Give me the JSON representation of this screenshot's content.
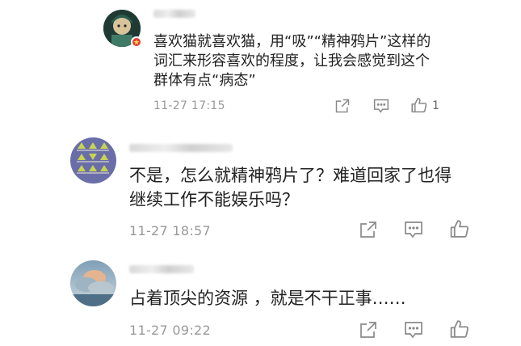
{
  "comments": [
    {
      "text_lines": [
        "喜欢猫就喜欢猫，用“吸”“精神鸦片”这样的",
        "词汇来形容喜欢的程度，让我会感觉到这个",
        "群体有点“病态”"
      ],
      "time": "11-27 17:15",
      "like_count": "1",
      "avatar_colors": [
        "#1f3b35",
        "#7fa89a",
        "#d9c8a0"
      ]
    },
    {
      "text_lines": [
        "不是，怎么就精神鸦片了？难道回家了也得",
        "继续工作不能娱乐吗？"
      ],
      "time": "11-27 18:57",
      "like_count": "",
      "avatar_colors": [
        "#6a6ea8",
        "#b7c84a",
        "#f0e9d0"
      ]
    },
    {
      "text_lines": [
        "占着顶尖的资源 ，就是不干正事……"
      ],
      "time": "11-27 09:22",
      "like_count": "",
      "avatar_colors": [
        "#8fa7b8",
        "#d9b08a",
        "#4f6f86"
      ]
    }
  ],
  "icons": {
    "share": "share-icon",
    "comment": "comment-icon",
    "like": "thumbs-up-icon",
    "badge": "badge-icon"
  },
  "colors": {
    "text": "#222222",
    "meta": "#999999",
    "icon": "#8a8a8a",
    "badge": "#e53935"
  }
}
